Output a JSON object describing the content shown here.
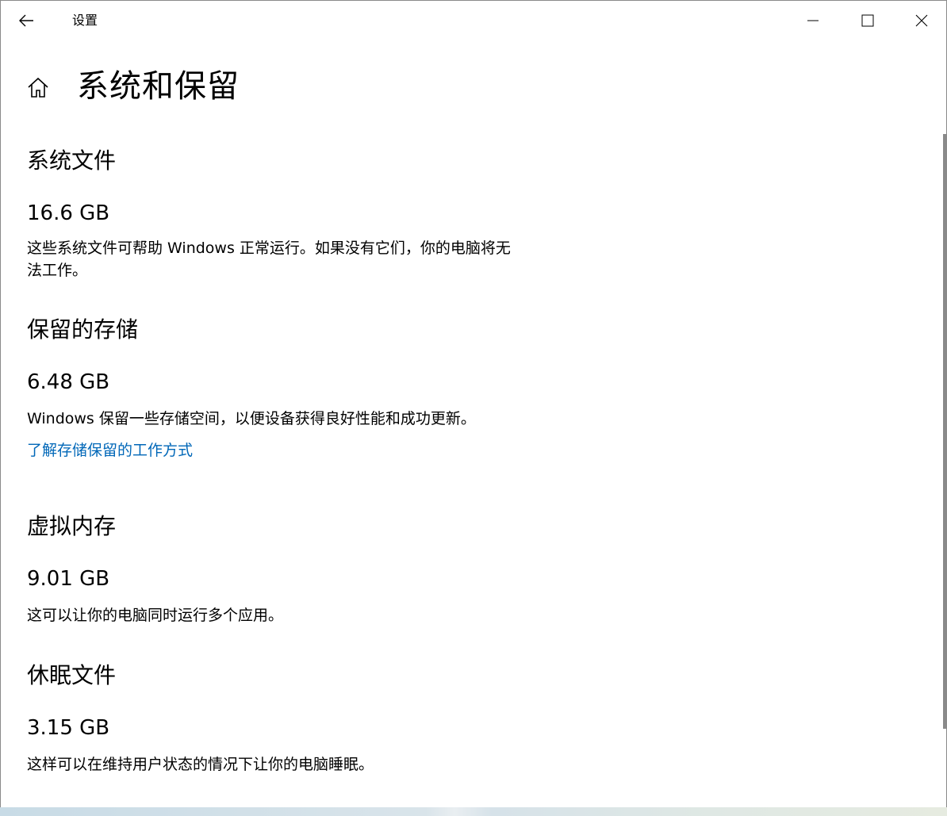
{
  "window": {
    "app_title": "设置"
  },
  "page": {
    "title": "系统和保留"
  },
  "sections": {
    "system_files": {
      "title": "系统文件",
      "size": "16.6 GB",
      "description_line1": "这些系统文件可帮助 Windows 正常运行。如果没有它们，你的电脑将无",
      "description_line2": "法工作。"
    },
    "reserved_storage": {
      "title": "保留的存储",
      "size": "6.48 GB",
      "description": "Windows 保留一些存储空间，以便设备获得良好性能和成功更新。",
      "link": "了解存储保留的工作方式"
    },
    "virtual_memory": {
      "title": "虚拟内存",
      "size": "9.01 GB",
      "description": "这可以让你的电脑同时运行多个应用。"
    },
    "hibernation_file": {
      "title": "休眠文件",
      "size": "3.15 GB",
      "description": "这样可以在维持用户状态的情况下让你的电脑睡眠。"
    }
  },
  "icons": {
    "back": "back-arrow-icon",
    "home": "home-icon",
    "minimize": "minimize-icon",
    "maximize": "maximize-icon",
    "close": "close-icon"
  },
  "colors": {
    "link": "#0067b8",
    "text": "#000000",
    "background": "#ffffff"
  }
}
